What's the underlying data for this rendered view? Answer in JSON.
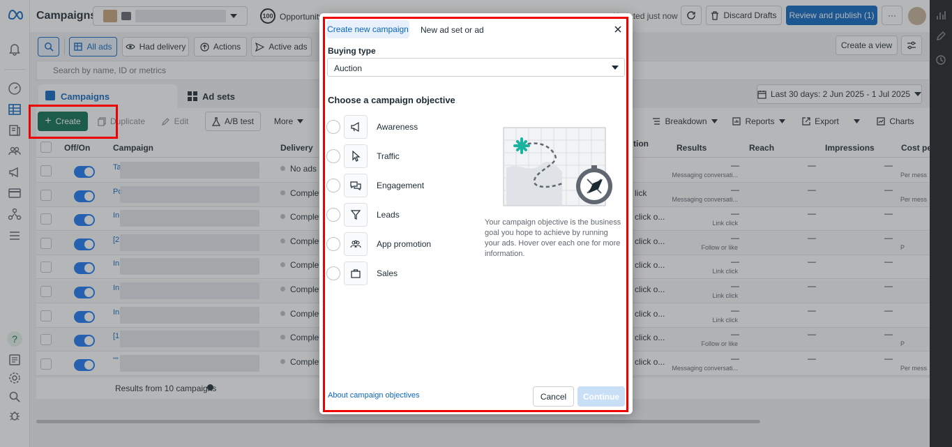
{
  "header": {
    "title": "Campaigns",
    "opportunity_score": "100",
    "opportunity_label": "Opportunity",
    "updated": "Updated just now",
    "discard": "Discard Drafts",
    "review": "Review and publish (1)",
    "more": "···"
  },
  "filters": {
    "all_ads": "All ads",
    "had_delivery": "Had delivery",
    "actions": "Actions",
    "active_ads": "Active ads",
    "search_placeholder": "Search by name, ID or metrics",
    "create_view": "Create a view"
  },
  "tabs": {
    "campaigns": "Campaigns",
    "ad_sets": "Ad sets"
  },
  "date_range": "Last 30 days: 2 Jun 2025 - 1 Jul 2025",
  "toolbar": {
    "create": "Create",
    "duplicate": "Duplicate",
    "edit": "Edit",
    "ab_test": "A/B test",
    "more": "More",
    "breakdown": "Breakdown",
    "reports": "Reports",
    "export": "Export",
    "charts": "Charts"
  },
  "table": {
    "columns": {
      "off_on": "Off/On",
      "campaign": "Campaign",
      "delivery": "Delivery",
      "attribution": "tion",
      "results": "Results",
      "reach": "Reach",
      "impressions": "Impressions",
      "cost": "Cost pe"
    },
    "rows": [
      {
        "name": "Ta",
        "delivery": "No ads",
        "attr": "",
        "result_type": "Messaging conversati...",
        "cost_type": "Per mess"
      },
      {
        "name": "Po",
        "delivery": "Complet",
        "attr": "lick",
        "result_type": "Messaging conversati...",
        "cost_type": "Per mess"
      },
      {
        "name": "In",
        "delivery": "Complet",
        "attr": "click o...",
        "result_type": "Link click",
        "cost_type": ""
      },
      {
        "name": "[2",
        "delivery": "Complet",
        "attr": "click o...",
        "result_type": "Follow or like",
        "cost_type": "P"
      },
      {
        "name": "In",
        "delivery": "Complet",
        "attr": "click o...",
        "result_type": "Link click",
        "cost_type": ""
      },
      {
        "name": "In",
        "delivery": "Complet",
        "attr": "click o...",
        "result_type": "Link click",
        "cost_type": ""
      },
      {
        "name": "In",
        "delivery": "Complet",
        "attr": "click o...",
        "result_type": "Link click",
        "cost_type": ""
      },
      {
        "name": "[1",
        "delivery": "Complet",
        "attr": "click o...",
        "result_type": "Follow or like",
        "cost_type": "P"
      },
      {
        "name": "\"\"",
        "delivery": "Complet",
        "attr": "click o...",
        "result_type": "Messaging conversati...",
        "cost_type": "Per mess"
      }
    ],
    "dash": "—",
    "footer": "Results from 10 campaigns"
  },
  "modal": {
    "tab_new_campaign": "Create new campaign",
    "tab_new_adset": "New ad set or ad",
    "buying_type_label": "Buying type",
    "buying_type_value": "Auction",
    "objective_heading": "Choose a campaign objective",
    "objectives": [
      {
        "label": "Awareness",
        "icon": "megaphone-icon"
      },
      {
        "label": "Traffic",
        "icon": "cursor-icon"
      },
      {
        "label": "Engagement",
        "icon": "chat-bubbles-icon"
      },
      {
        "label": "Leads",
        "icon": "funnel-icon"
      },
      {
        "label": "App promotion",
        "icon": "people-icon"
      },
      {
        "label": "Sales",
        "icon": "shopping-bag-icon"
      }
    ],
    "description": "Your campaign objective is the business goal you hope to achieve by running your ads. Hover over each one for more information.",
    "about_link": "About campaign objectives",
    "cancel": "Cancel",
    "continue": "Continue"
  },
  "colors": {
    "accent": "#0a66c2",
    "create_green": "#0b6e4f",
    "highlight_red": "#e00000",
    "link": "#0a66c2"
  }
}
